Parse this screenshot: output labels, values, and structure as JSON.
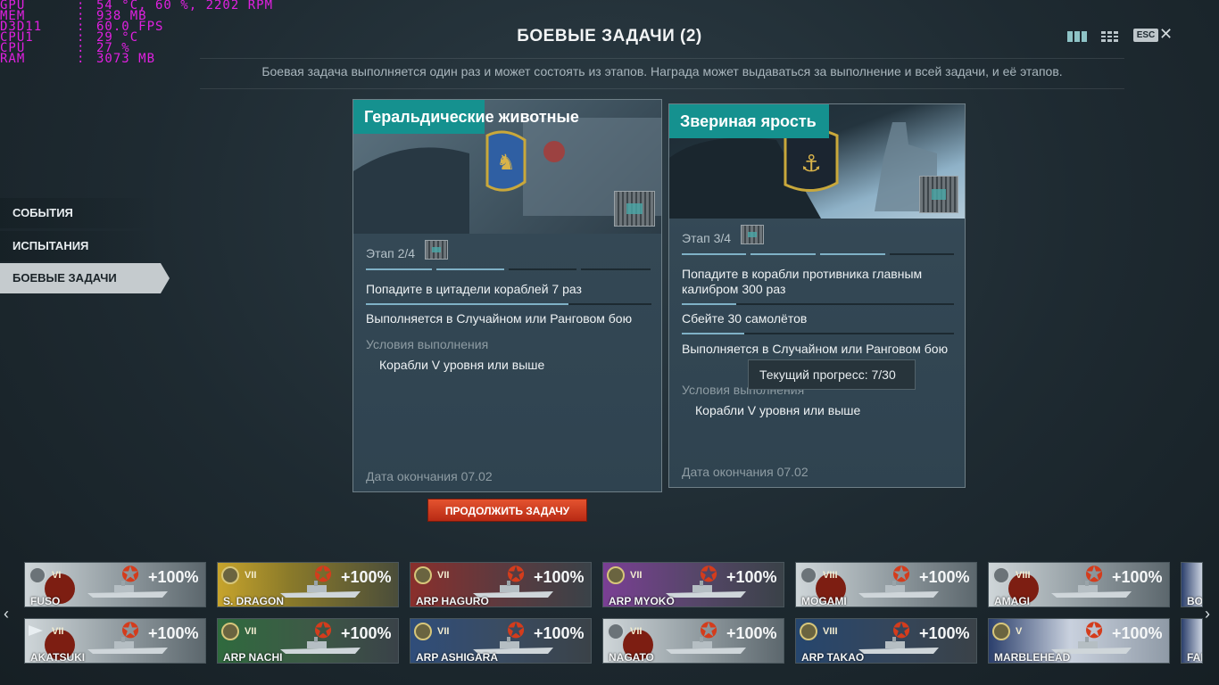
{
  "overlay": {
    "rows": [
      {
        "key": "GPU",
        "value": "54 °C, 60 %, 2202 RPM"
      },
      {
        "key": "MEM",
        "value": "938 MB"
      },
      {
        "key": "D3D11",
        "value": "60.0 FPS"
      },
      {
        "key": "CPU1",
        "value": "29 °C"
      },
      {
        "key": "CPU",
        "value": "27 %"
      },
      {
        "key": "RAM",
        "value": "3073 MB"
      }
    ]
  },
  "header": {
    "title": "БОЕВЫЕ ЗАДАЧИ (2)",
    "description": "Боевая задача выполняется один раз и может состоять из этапов. Награда может выдаваться за выполнение и всей задачи, и её этапов.",
    "esc_label": "ESC",
    "close_icon": "✕"
  },
  "menu": {
    "items": [
      {
        "label": "СОБЫТИЯ",
        "active": false
      },
      {
        "label": "ИСПЫТАНИЯ",
        "active": false
      },
      {
        "label": "БОЕВЫЕ ЗАДАЧИ",
        "active": true
      }
    ]
  },
  "cards": [
    {
      "title": "Геральдические животные",
      "stage": "Этап 2/4",
      "task": "Попадите в цитадели кораблей 7 раз",
      "task_progress": 0.71,
      "mode": "Выполняется в Случайном или Ранговом бою",
      "conditions_label": "Условия выполнения",
      "condition": "Корабли V уровня или выше",
      "end_date": "Дата окончания 07.02"
    },
    {
      "title": "Звериная ярость",
      "stage": "Этап 3/4",
      "task1": "Попадите в корабли противника главным калибром 300 раз",
      "task1_progress": 0.2,
      "task2": "Сбейте 30 самолётов",
      "task2_progress": 0.23,
      "mode": "Выполняется в Случайном или Ранговом бою",
      "conditions_label": "Условия выполнения",
      "condition": "Корабли V уровня или выше",
      "end_date": "Дата окончания 07.02"
    }
  ],
  "tooltip": "Текущий прогресс: 7/30",
  "continue_button": "ПРОДОЛЖИТЬ ЗАДАЧУ",
  "ships": [
    {
      "name": "FUSO",
      "tier": "VI",
      "bonus": "+100%",
      "nation": "japan",
      "badge": "grey"
    },
    {
      "name": "S. DRAGON",
      "tier": "VII",
      "bonus": "+100%",
      "nation": "pan-asia",
      "badge": "gold"
    },
    {
      "name": "ARP HAGURO",
      "tier": "VII",
      "bonus": "+100%",
      "nation": "arp-red",
      "badge": "gold"
    },
    {
      "name": "ARP MYOKO",
      "tier": "VII",
      "bonus": "+100%",
      "nation": "arp-purple",
      "badge": "gold"
    },
    {
      "name": "MOGAMI",
      "tier": "VIII",
      "bonus": "+100%",
      "nation": "japan",
      "badge": "grey"
    },
    {
      "name": "AMAGI",
      "tier": "VIII",
      "bonus": "+100%",
      "nation": "japan",
      "badge": "grey"
    },
    {
      "name": "AKATSUKI",
      "tier": "VII",
      "bonus": "+100%",
      "nation": "japan",
      "badge": "flag"
    },
    {
      "name": "ARP NACHI",
      "tier": "VII",
      "bonus": "+100%",
      "nation": "arp-green",
      "badge": "gold"
    },
    {
      "name": "ARP ASHIGARA",
      "tier": "VII",
      "bonus": "+100%",
      "nation": "arp-blue",
      "badge": "gold"
    },
    {
      "name": "NAGATO",
      "tier": "VII",
      "bonus": "+100%",
      "nation": "japan",
      "badge": "grey"
    },
    {
      "name": "ARP TAKAO",
      "tier": "VIII",
      "bonus": "+100%",
      "nation": "arp-navy",
      "badge": "gold"
    },
    {
      "name": "MARBLEHEAD",
      "tier": "V",
      "bonus": "+100%",
      "nation": "usa",
      "badge": "gold"
    }
  ],
  "ships_partial": [
    {
      "name": "BO"
    },
    {
      "name": "FAR"
    }
  ],
  "colors": {
    "accent_teal": "#15918f",
    "button_red": "#c83a1c",
    "overlay_magenta": "#e020e0"
  }
}
